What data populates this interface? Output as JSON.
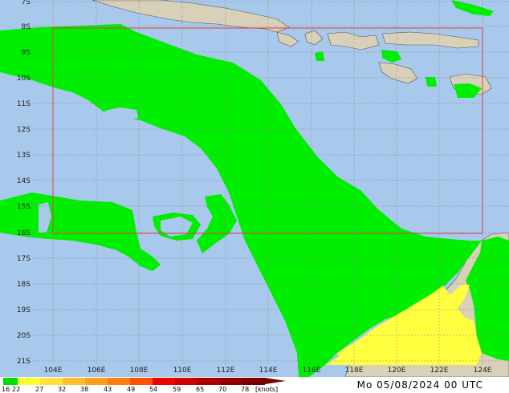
{
  "map": {
    "lat_labels": [
      "7S",
      "8S",
      "9S",
      "10S",
      "11S",
      "12S",
      "13S",
      "14S",
      "15S",
      "16S",
      "17S",
      "18S",
      "19S",
      "20S",
      "21S"
    ],
    "lon_labels": [
      "104E",
      "106E",
      "108E",
      "110E",
      "112E",
      "114E",
      "116E",
      "118E",
      "120E",
      "122E",
      "124E"
    ],
    "colors": {
      "ocean": "#a8c8ec",
      "land": "#d8d0b8",
      "wind_16_22": "#00ee00",
      "wind_22_27": "#ffff40",
      "grid": "#888888",
      "frame": "#e04040"
    }
  },
  "legend": {
    "labels": [
      "16",
      "22",
      "27",
      "32",
      "38",
      "43",
      "49",
      "54",
      "59",
      "65",
      "70",
      "78"
    ],
    "unit": "[knots]",
    "colors": [
      "#00dd00",
      "#ffff30",
      "#ffe040",
      "#ffc030",
      "#ffa020",
      "#ff8010",
      "#ff5000",
      "#ee0000",
      "#cc0000",
      "#aa0000",
      "#900000",
      "#780000"
    ]
  },
  "timestamp": "Mo 05/08/2024 00 UTC"
}
